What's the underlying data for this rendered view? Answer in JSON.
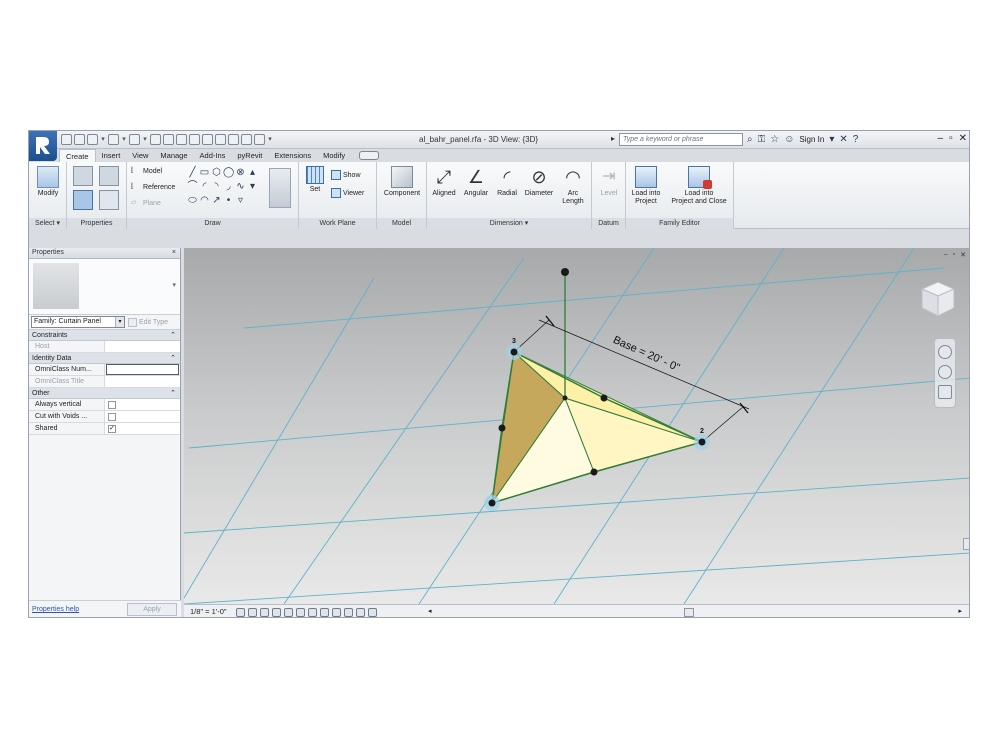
{
  "window": {
    "document_title": "al_bahr_panel.rfa - 3D View: {3D}",
    "search_placeholder": "Type a keyword or phrase",
    "sign_in": "Sign In",
    "help_glyph": "?",
    "icons": [
      "binoculars-icon",
      "subscription-icon",
      "star-icon",
      "user-icon",
      "exchange-icon",
      "help-icon"
    ]
  },
  "tabs": [
    "Create",
    "Insert",
    "View",
    "Manage",
    "Add-Ins",
    "pyRevit",
    "Extensions",
    "Modify"
  ],
  "active_tab": "Create",
  "ribbon": {
    "select": {
      "modify_label": "Modify",
      "panel_title": "Select"
    },
    "properties": {
      "panel_title": "Properties"
    },
    "draw": {
      "model_label": "Model",
      "reference_label": "Reference",
      "plane_label": "Plane",
      "panel_title": "Draw"
    },
    "work_plane": {
      "set_label": "Set",
      "show_label": "Show",
      "viewer_label": "Viewer",
      "panel_title": "Work Plane"
    },
    "model": {
      "component_label": "Component",
      "panel_title": "Model"
    },
    "dimension": {
      "aligned": "Aligned",
      "angular": "Angular",
      "radial": "Radial",
      "diameter": "Diameter",
      "arc_length_1": "Arc",
      "arc_length_2": "Length",
      "panel_title": "Dimension"
    },
    "datum": {
      "level_label": "Level",
      "panel_title": "Datum"
    },
    "family_editor": {
      "load_project_1": "Load into",
      "load_project_2": "Project",
      "load_close_1": "Load into",
      "load_close_2": "Project and Close",
      "panel_title": "Family Editor"
    }
  },
  "properties_palette": {
    "title": "Properties",
    "close_glyph": "×",
    "family_select": "Family: Curtain Panel",
    "edit_type": "Edit Type",
    "groups": [
      {
        "name": "Constraints",
        "rows": [
          {
            "key": "Host",
            "value": "",
            "dim": true
          }
        ]
      },
      {
        "name": "Identity Data",
        "rows": [
          {
            "key": "OmniClass Num...",
            "value": ""
          },
          {
            "key": "OmniClass Title",
            "value": "",
            "dim": true
          }
        ]
      },
      {
        "name": "Other",
        "rows": [
          {
            "key": "Always vertical",
            "checked": false
          },
          {
            "key": "Cut with Voids ...",
            "checked": false
          },
          {
            "key": "Shared",
            "checked": true
          }
        ]
      }
    ],
    "help_link": "Properties help",
    "apply": "Apply"
  },
  "view": {
    "scale": "1/8\" = 1'-0\"",
    "dimension_text": "Base = 20' - 0\"",
    "reference_numbers": [
      "3",
      "2"
    ],
    "colors": {
      "panel_fill": "#fff6c4",
      "panel_shade": "#c6a85c",
      "edge": "#2f7d3a",
      "grid": "#5cb3c9"
    }
  }
}
